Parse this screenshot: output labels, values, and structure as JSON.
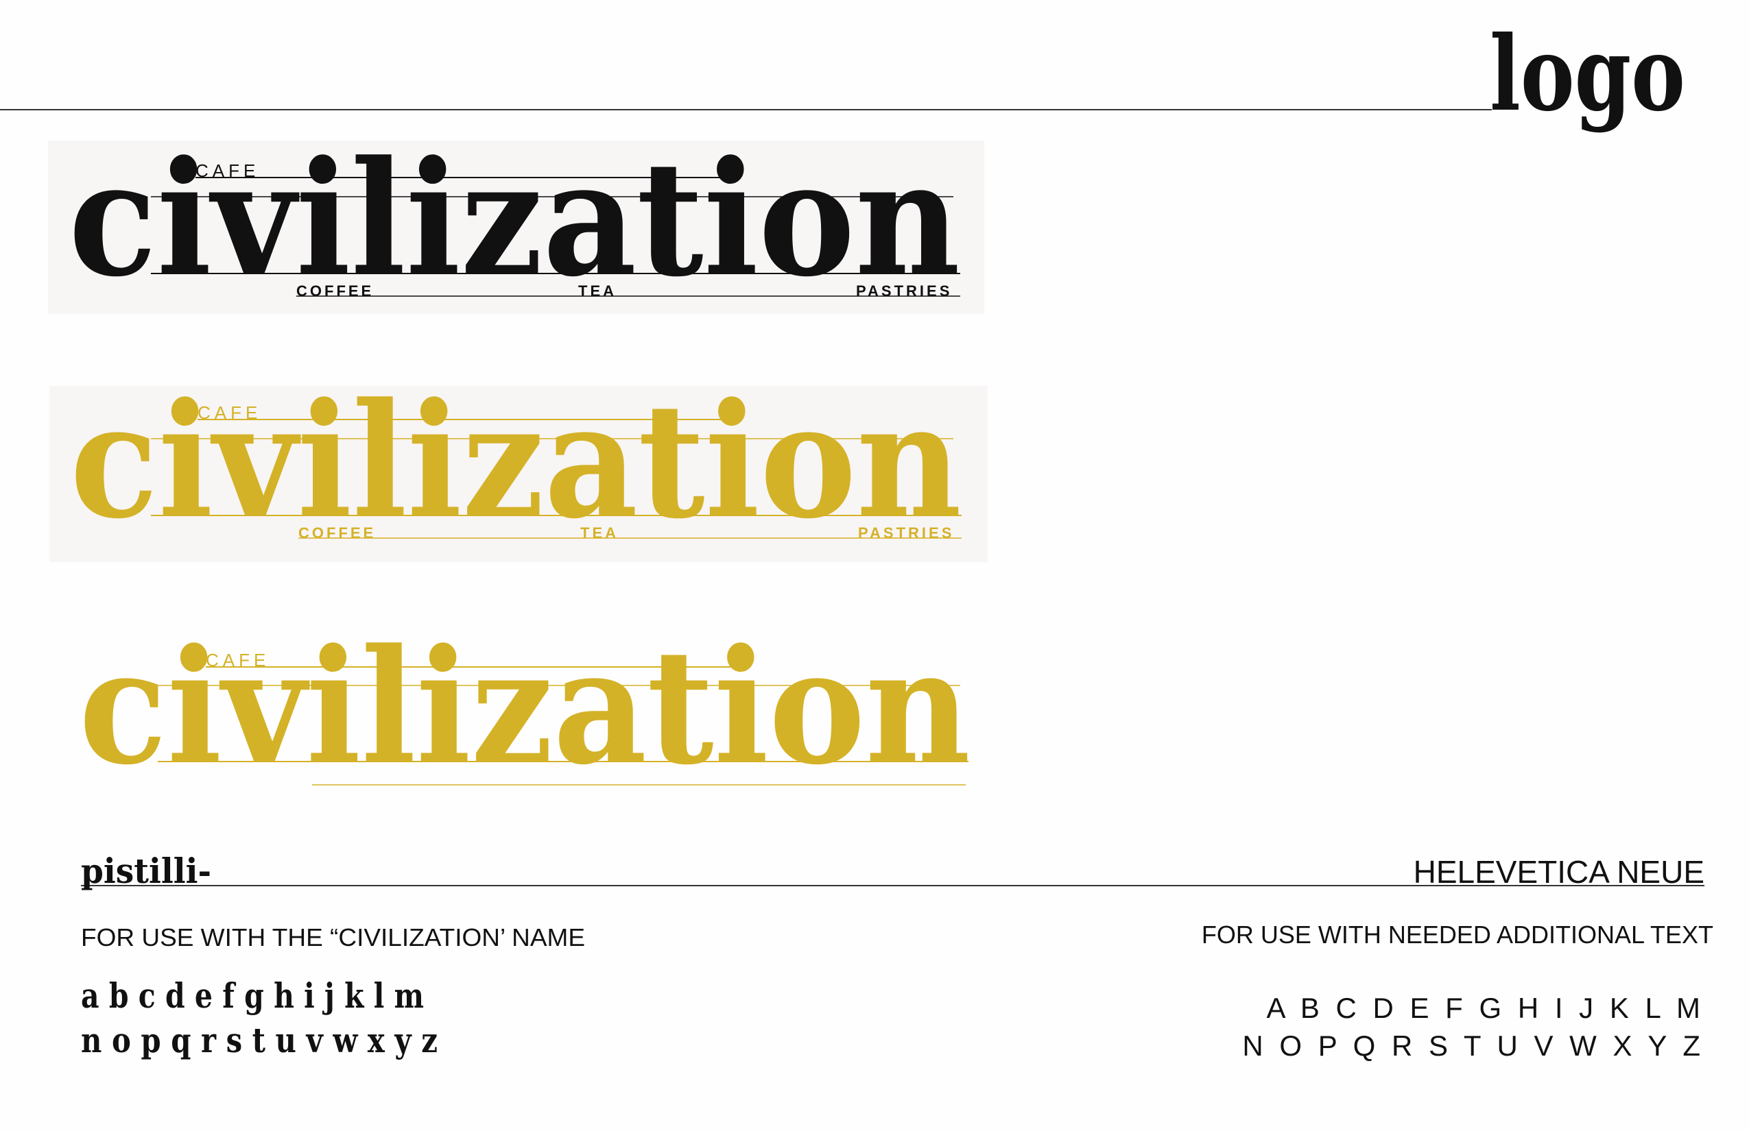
{
  "header": {
    "title": "logo"
  },
  "colors": {
    "black": "#111111",
    "gold": "#d4b227",
    "panel": "#f8f5f5"
  },
  "logos": [
    {
      "variant": "black",
      "cafe": "CAFE",
      "name": "civilization",
      "tagline": [
        "COFFEE",
        "TEA",
        "PASTRIES"
      ]
    },
    {
      "variant": "gold",
      "cafe": "CAFE",
      "name": "civilization",
      "tagline": [
        "COFFEE",
        "TEA",
        "PASTRIES"
      ]
    },
    {
      "variant": "gold-no-panel",
      "cafe": "CAFE",
      "name": "civilization"
    }
  ],
  "typefaces": {
    "primary": {
      "name": "pistilli-",
      "usage": "FOR USE WITH THE “CIVILIZATION’ NAME",
      "alphabet_line1": "a b c d e f g h i j k l m",
      "alphabet_line2": "n o p q r s t u v w x y z"
    },
    "secondary": {
      "name": "HELEVETICA NEUE",
      "usage": "FOR USE WITH NEEDED ADDITIONAL TEXT",
      "alphabet_line1": "A B C D E F G H I J K L M",
      "alphabet_line2": "N O P Q R S T U V W X Y Z"
    }
  }
}
